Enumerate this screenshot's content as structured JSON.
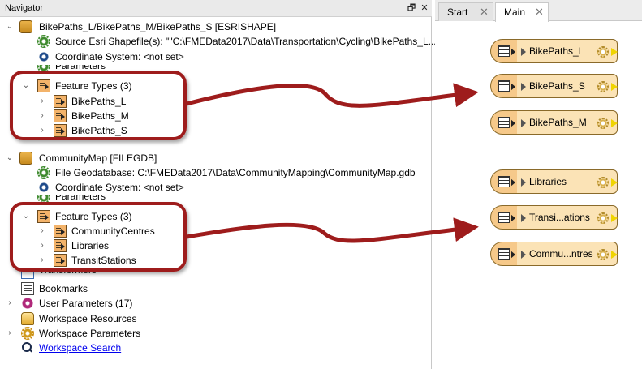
{
  "navigator": {
    "title": "Navigator",
    "float_glyph": "🗗",
    "close_glyph": "✕",
    "bikepaths": {
      "dataset": "BikePaths_L/BikePaths_M/BikePaths_S [ESRISHAPE]",
      "source": "Source Esri Shapefile(s): \"\"C:\\FMEData2017\\Data\\Transportation\\Cycling\\BikePaths_L....",
      "coord": "Coordinate System: <not set>",
      "params": "Parameters",
      "feature_types": "Feature Types (3)",
      "types": [
        "BikePaths_L",
        "BikePaths_M",
        "BikePaths_S"
      ]
    },
    "community": {
      "dataset": "CommunityMap [FILEGDB]",
      "source": "File Geodatabase: C:\\FMEData2017\\Data\\CommunityMapping\\CommunityMap.gdb",
      "coord": "Coordinate System: <not set>",
      "params": "Parameters",
      "feature_types": "Feature Types (3)",
      "types": [
        "CommunityCentres",
        "Libraries",
        "TransitStations"
      ]
    },
    "transformers": "Transformers",
    "bookmarks": "Bookmarks",
    "user_params": "User Parameters (17)",
    "ws_resources": "Workspace Resources",
    "ws_params": "Workspace Parameters",
    "ws_search": "Workspace Search"
  },
  "tabs": {
    "start": "Start",
    "main": "Main",
    "close_glyph": "✕"
  },
  "readers": [
    "BikePaths_L",
    "BikePaths_S",
    "BikePaths_M",
    "Libraries",
    "Transi...ations",
    "Commu...ntres"
  ],
  "colors": {
    "callout": "#9e1c1c",
    "reader_fill": "#fbe3b6",
    "output_port": "#f0d400"
  }
}
